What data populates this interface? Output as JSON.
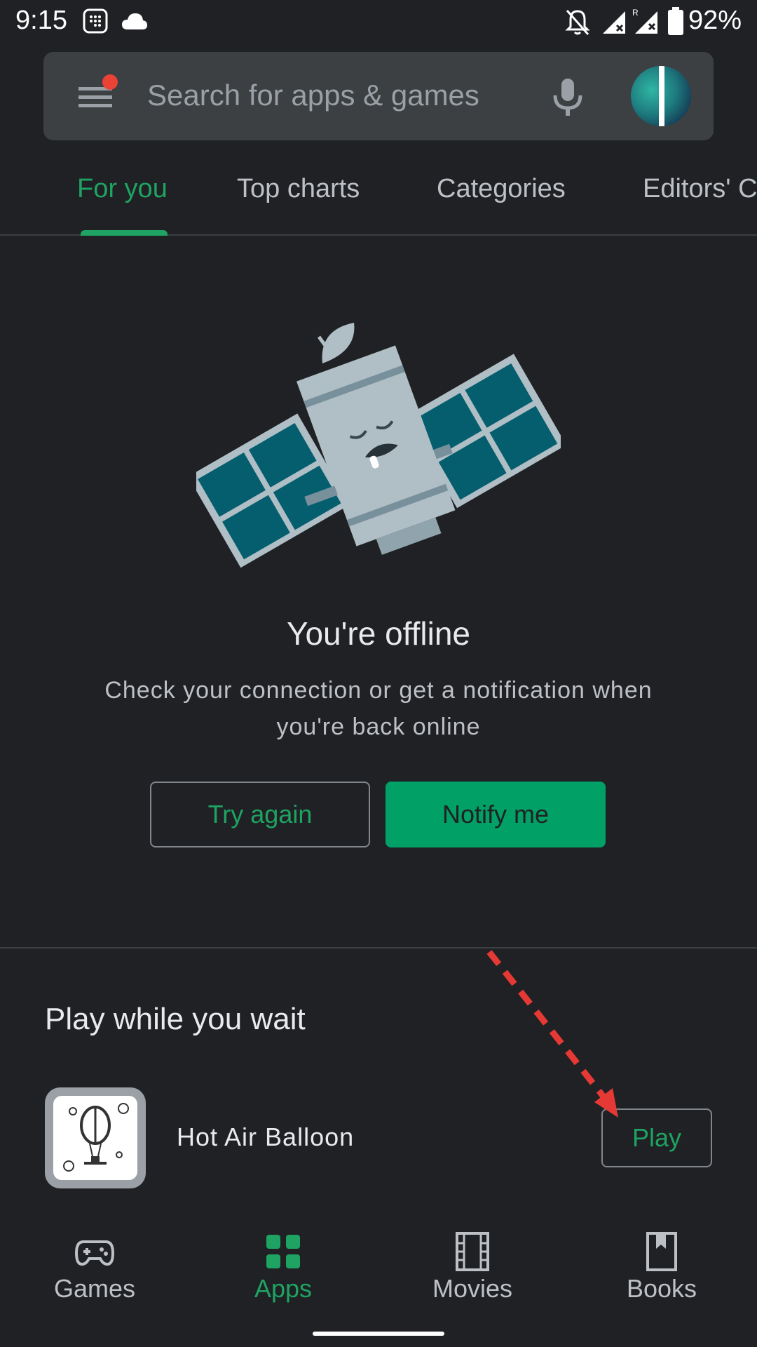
{
  "status_bar": {
    "time": "9:15",
    "battery_percent": "92%",
    "icons": [
      "calculator-icon",
      "cloud-icon",
      "notifications-off-icon",
      "signal-icon",
      "signal-roaming-icon",
      "battery-icon"
    ]
  },
  "search": {
    "placeholder": "Search for apps & games",
    "icons": [
      "menu-icon",
      "mic-icon",
      "avatar"
    ]
  },
  "tabs": [
    {
      "label": "For you",
      "active": true
    },
    {
      "label": "Top charts",
      "active": false
    },
    {
      "label": "Categories",
      "active": false
    },
    {
      "label": "Editors' C",
      "active": false
    }
  ],
  "offline": {
    "illustration": "satellite-icon",
    "title": "You're offline",
    "message": "Check your connection or get a notification when you're back online",
    "try_again": "Try again",
    "notify_me": "Notify me"
  },
  "play_section": {
    "title": "Play while you wait",
    "game": {
      "name": "Hot Air Balloon",
      "icon": "hot-air-balloon-icon",
      "button": "Play"
    }
  },
  "bottom_nav": [
    {
      "label": "Games",
      "icon": "gamepad-icon",
      "active": false
    },
    {
      "label": "Apps",
      "icon": "apps-grid-icon",
      "active": true
    },
    {
      "label": "Movies",
      "icon": "film-icon",
      "active": false
    },
    {
      "label": "Books",
      "icon": "bookmark-icon",
      "active": false
    }
  ],
  "colors": {
    "background": "#202124",
    "search_bar": "#3c4043",
    "accent_green": "#1ea362",
    "button_green": "#01a066",
    "annotation_arrow": "#e53935"
  }
}
